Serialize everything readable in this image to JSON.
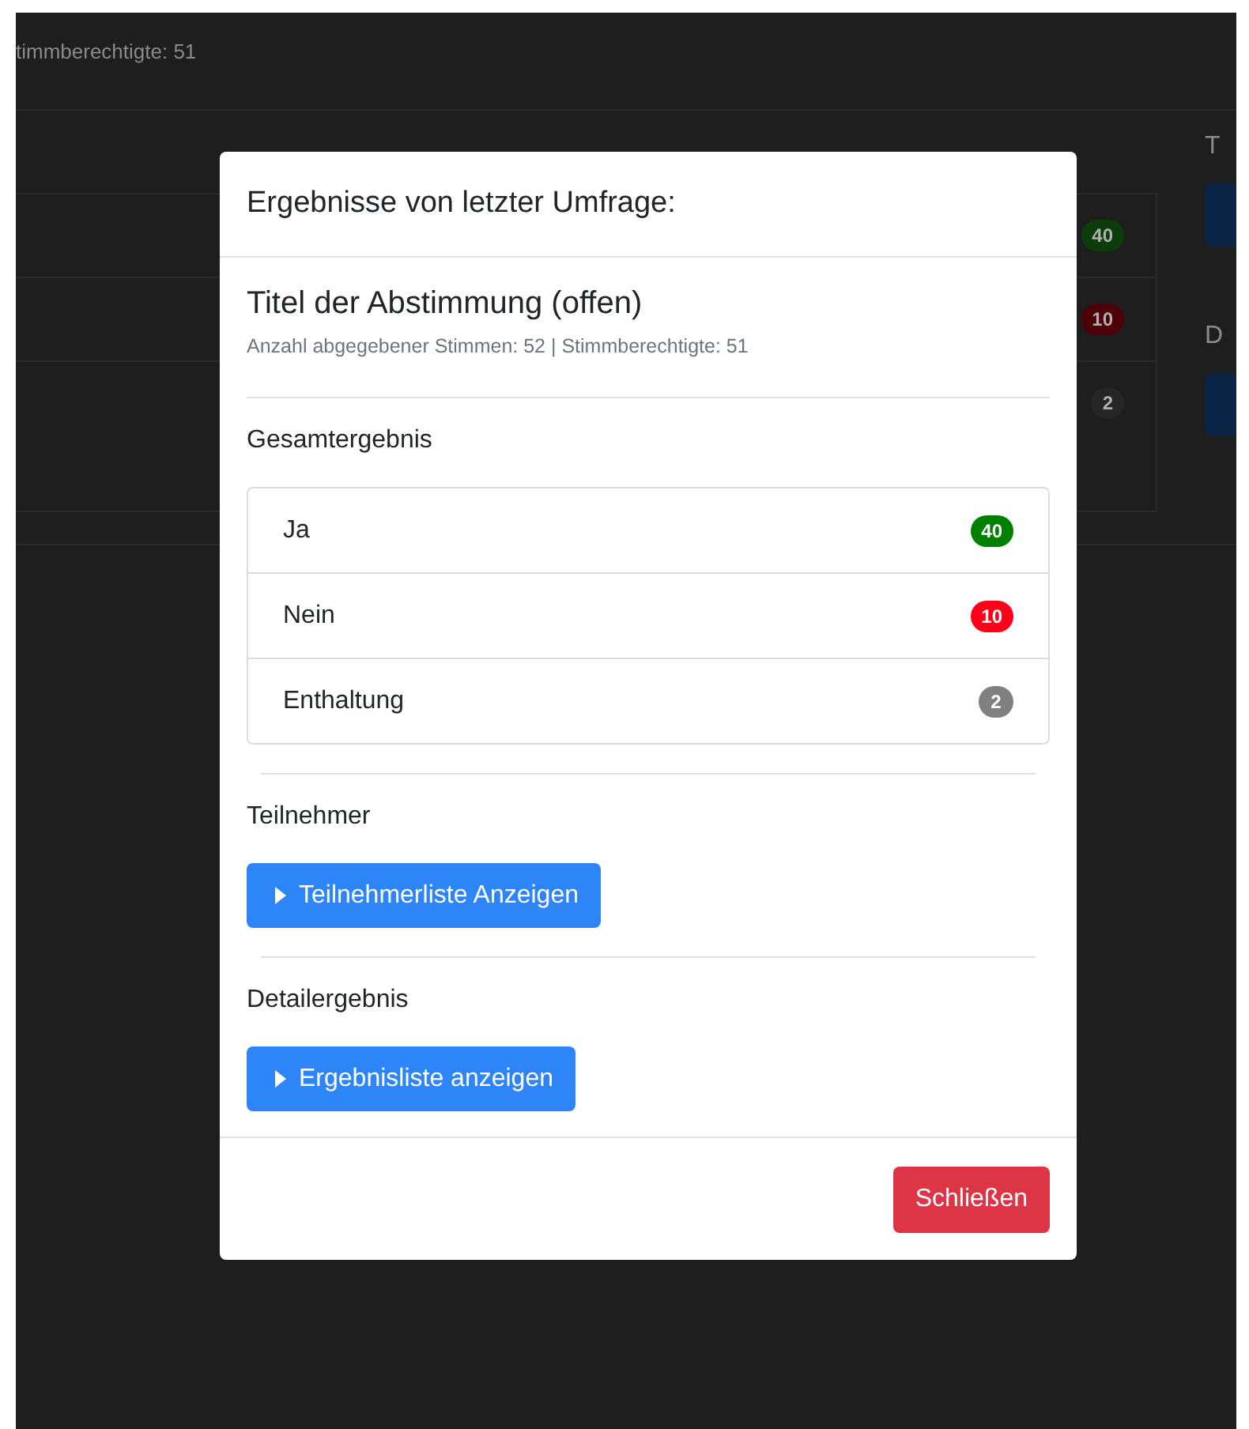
{
  "background_page": {
    "subtitle": "timmberechtigte: 51",
    "results": [
      {
        "count": "40",
        "color": "#0b3d0b"
      },
      {
        "count": "10",
        "color": "#4d0007"
      },
      {
        "count": "2",
        "color": "#262626"
      }
    ],
    "side_labels": [
      "T",
      "D"
    ]
  },
  "modal": {
    "title": "Ergebnisse von letzter Umfrage:",
    "poll_title": "Titel der Abstimmung (offen)",
    "poll_meta": "Anzahl abgegebener Stimmen: 52 | Stimmberechtigte: 51",
    "sections": [
      {
        "kind": "results",
        "heading": "Gesamtergebnis",
        "items": [
          {
            "label": "Ja",
            "count": "40",
            "color": "#008000"
          },
          {
            "label": "Nein",
            "count": "10",
            "color": "#ff0019"
          },
          {
            "label": "Enthaltung",
            "count": "2",
            "color": "#808080"
          }
        ]
      },
      {
        "kind": "toggle",
        "heading": "Teilnehmer",
        "button": "Teilnehmerliste Anzeigen",
        "expanded": false
      },
      {
        "kind": "toggle",
        "heading": "Detailergebnis",
        "button": "Ergebnisliste anzeigen",
        "expanded": false
      }
    ],
    "close_button": "Schließen"
  }
}
